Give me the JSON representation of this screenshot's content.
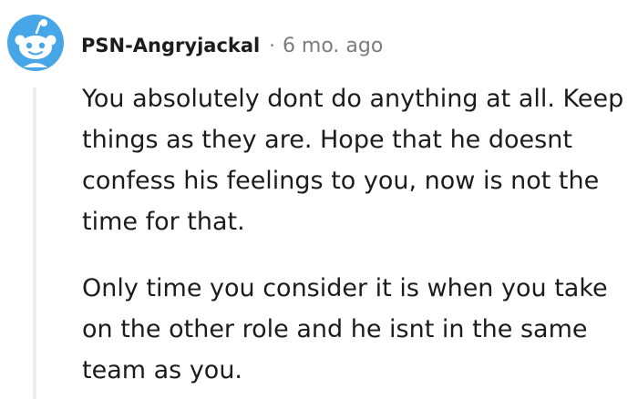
{
  "comment": {
    "author": "PSN-Angryjackal",
    "separator": "·",
    "timestamp": "6 mo. ago",
    "avatar_icon": "reddit-snoo-avatar-icon",
    "paragraphs": [
      "You absolutely dont do anything at all. Keep things as they are. Hope that he doesnt confess his feelings to you, now is not the time for that.",
      "Only time you consider it is when you take on the other role and he isnt in the same team as you."
    ]
  },
  "colors": {
    "avatar_background": "#46a6e8",
    "text": "#1c1c1c",
    "meta": "#7c7c7c",
    "thread_line": "#ededed"
  }
}
